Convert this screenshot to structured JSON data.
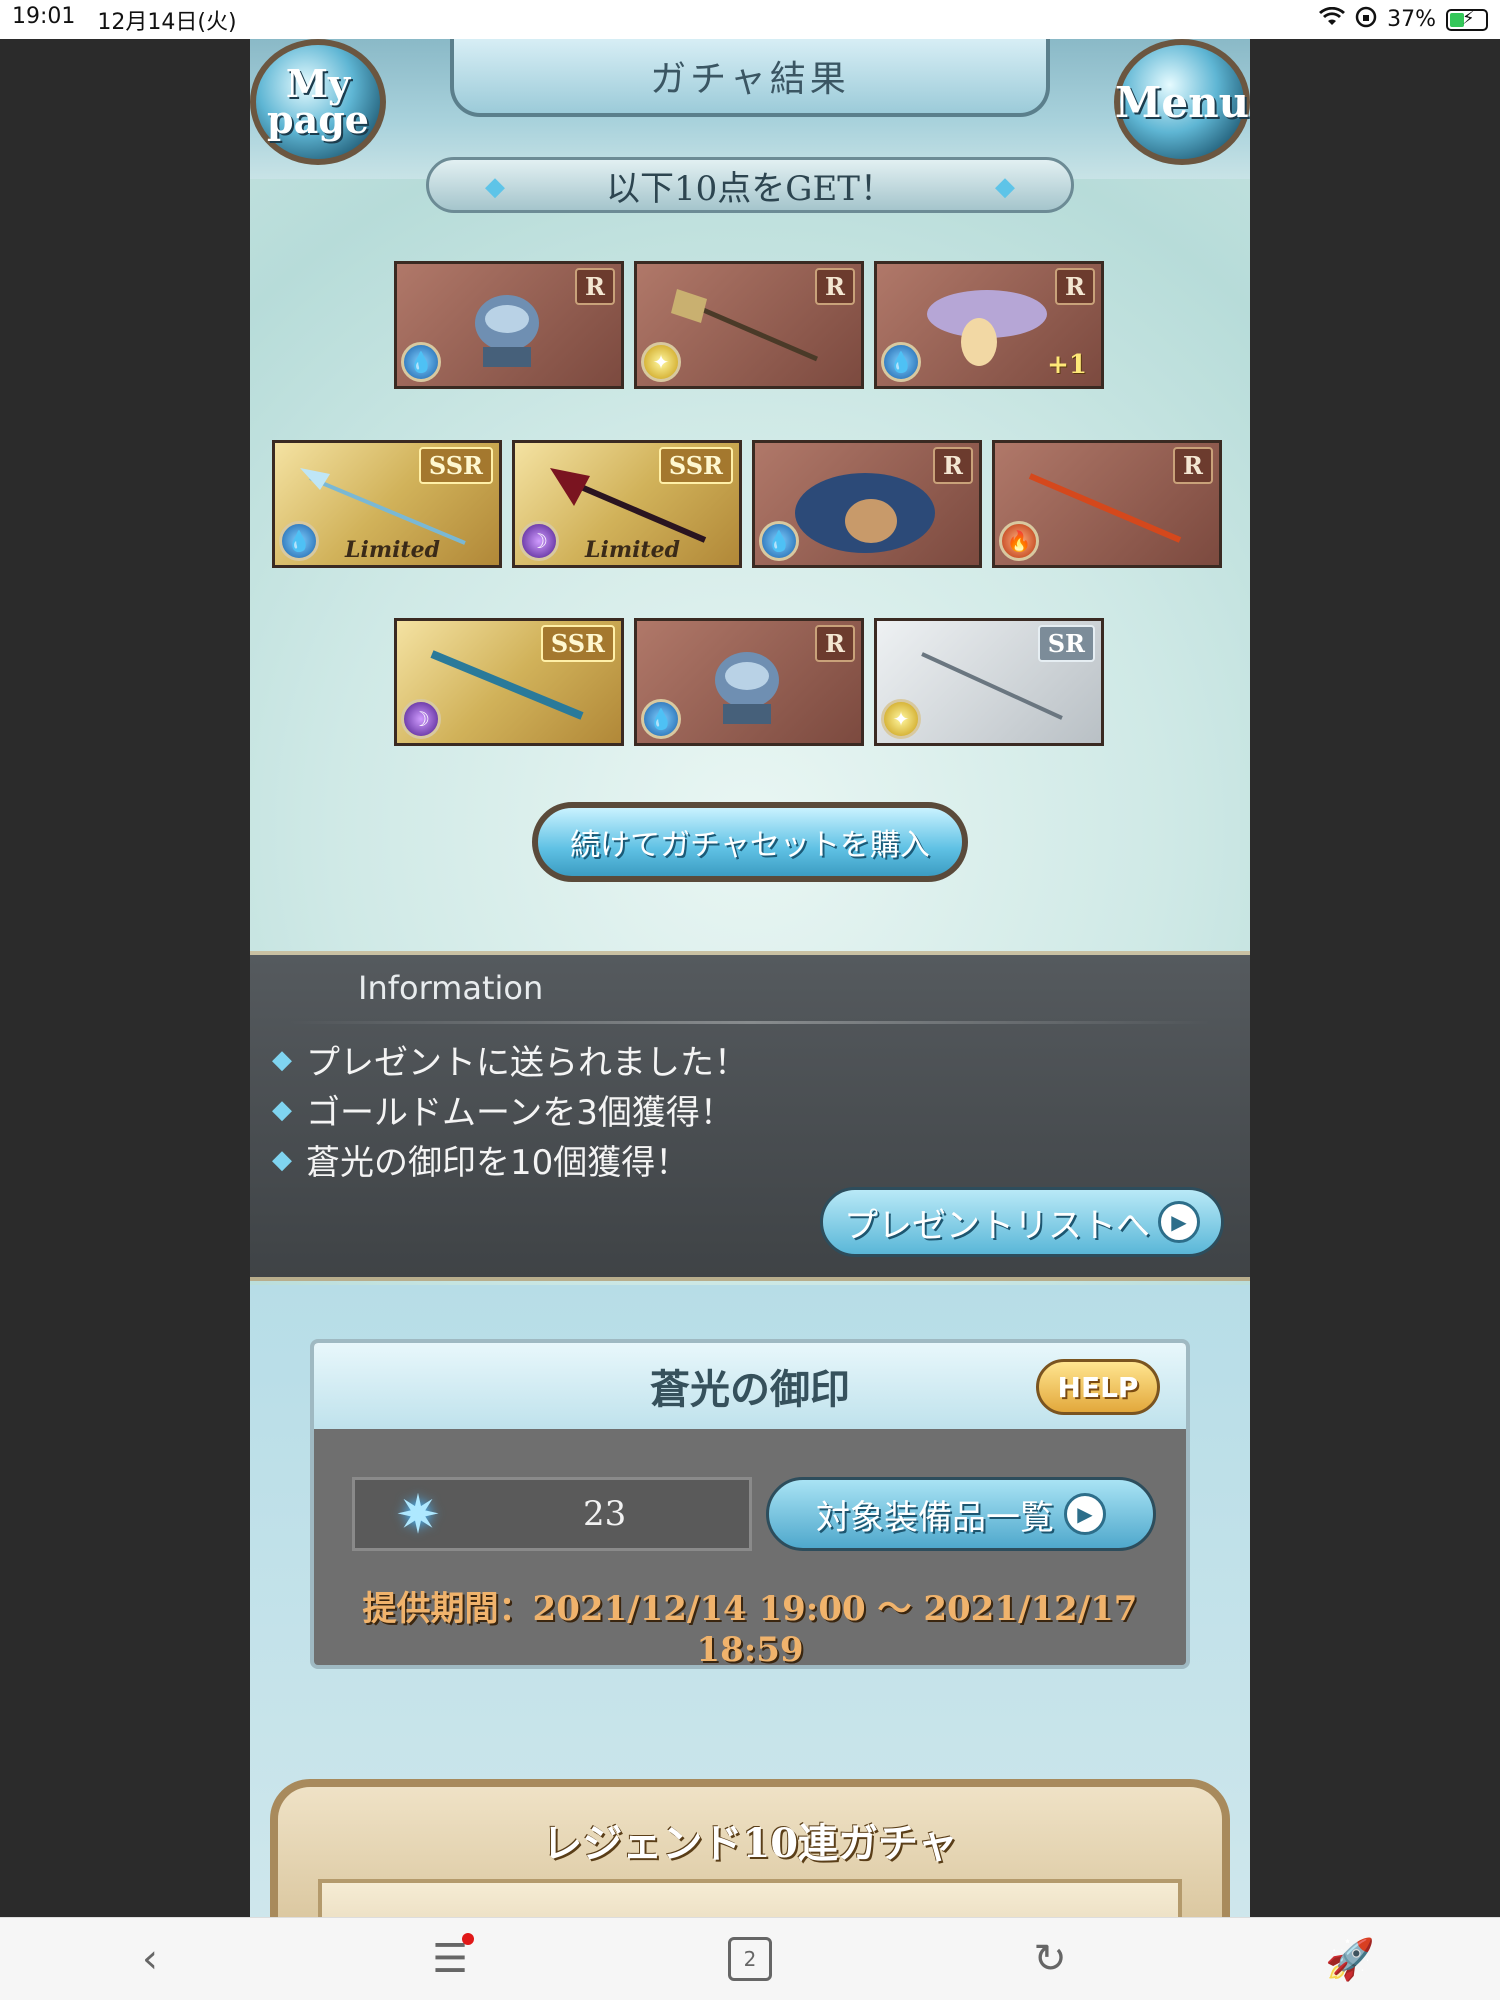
{
  "status": {
    "time": "19:01",
    "date": "12月14日(火)",
    "battery": "37%"
  },
  "header": {
    "title": "ガチャ結果",
    "mypage_label": "My page",
    "menu_label": "Menu"
  },
  "result": {
    "banner": "以下10点をGET！",
    "continue_label": "続けてガチャセットを購入",
    "items": [
      {
        "rarity": "R",
        "element": "water",
        "tag": "",
        "plus": ""
      },
      {
        "rarity": "R",
        "element": "light",
        "tag": "",
        "plus": ""
      },
      {
        "rarity": "R",
        "element": "water",
        "tag": "",
        "plus": "+1"
      },
      {
        "rarity": "SSR",
        "element": "water",
        "tag": "Limited",
        "plus": ""
      },
      {
        "rarity": "SSR",
        "element": "dark",
        "tag": "Limited",
        "plus": ""
      },
      {
        "rarity": "R",
        "element": "water",
        "tag": "",
        "plus": ""
      },
      {
        "rarity": "R",
        "element": "fire",
        "tag": "",
        "plus": ""
      },
      {
        "rarity": "SSR",
        "element": "dark",
        "tag": "",
        "plus": ""
      },
      {
        "rarity": "R",
        "element": "water",
        "tag": "",
        "plus": ""
      },
      {
        "rarity": "SR",
        "element": "light",
        "tag": "",
        "plus": ""
      }
    ]
  },
  "information": {
    "title": "Information",
    "messages": [
      "プレゼントに送られました！",
      "ゴールドムーンを3個獲得！",
      "蒼光の御印を10個獲得！"
    ],
    "present_button": "プレゼントリストへ"
  },
  "seal": {
    "title": "蒼光の御印",
    "help_label": "HELP",
    "count": "23",
    "target_button": "対象装備品一覧",
    "period": "提供期間：2021/12/14 19:00 〜 2021/12/17 18:59"
  },
  "legend": {
    "title": "レジェンド10連ガチャ"
  },
  "browser": {
    "tab_count": "2"
  },
  "colors": {
    "water": "#1a5fa8",
    "light": "#c79a10",
    "dark": "#4a1a8a",
    "fire": "#b7320c"
  }
}
